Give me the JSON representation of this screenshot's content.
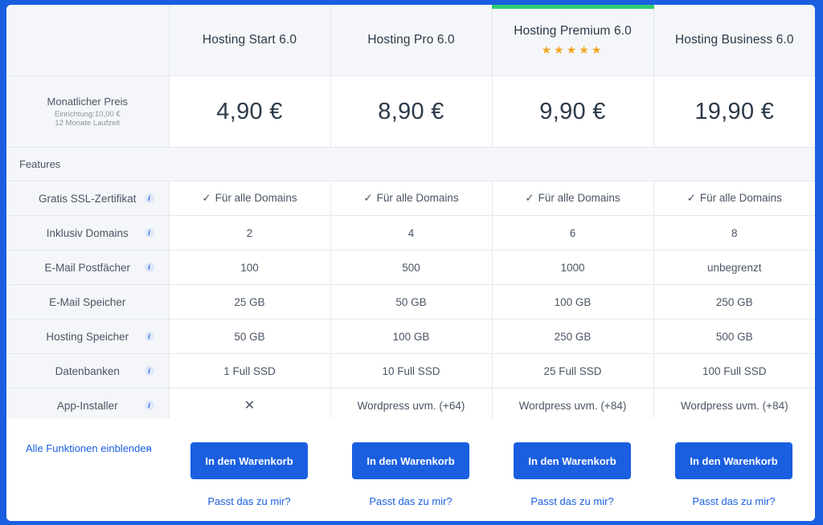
{
  "plans": [
    {
      "name": "Hosting Start 6.0",
      "price": "4,90 €",
      "ssl": "Für alle Domains",
      "domains": "2",
      "mailboxes": "100",
      "mail_storage": "25 GB",
      "hosting_storage": "50 GB",
      "databases": "1 Full SSD",
      "app_installer": "",
      "app_installer_icon": "cross-icon",
      "cart": "In den Warenkorb",
      "fit": "Passt das zu mir?"
    },
    {
      "name": "Hosting Pro 6.0",
      "price": "8,90 €",
      "ssl": "Für alle Domains",
      "domains": "4",
      "mailboxes": "500",
      "mail_storage": "50 GB",
      "hosting_storage": "100 GB",
      "databases": "10 Full SSD",
      "app_installer": "Wordpress uvm. (+64)",
      "cart": "In den Warenkorb",
      "fit": "Passt das zu mir?"
    },
    {
      "name": "Hosting Premium 6.0",
      "price": "9,90 €",
      "ssl": "Für alle Domains",
      "domains": "6",
      "mailboxes": "1000",
      "mail_storage": "100 GB",
      "hosting_storage": "250 GB",
      "databases": "25 Full SSD",
      "app_installer": "Wordpress uvm. (+84)",
      "cart": "In den Warenkorb",
      "fit": "Passt das zu mir?",
      "stars": "★★★★★",
      "rating": 5
    },
    {
      "name": "Hosting Business 6.0",
      "price": "19,90 €",
      "ssl": "Für alle Domains",
      "domains": "8",
      "mailboxes": "unbegrenzt",
      "mail_storage": "250 GB",
      "hosting_storage": "500 GB",
      "databases": "100 Full SSD",
      "app_installer": "Wordpress uvm. (+84)",
      "cart": "In den Warenkorb",
      "fit": "Passt das zu mir?"
    }
  ],
  "labels": {
    "price": "Monatlicher Preis",
    "setup": "Einrichtung:10,00 €",
    "term": "12 Monate Laufzeit",
    "features": "Features",
    "ssl": "Gratis SSL-Zertifikat",
    "domains": "Inklusiv Domains",
    "mailboxes": "E-Mail Postfächer",
    "mail_storage": "E-Mail Speicher",
    "hosting_storage": "Hosting Speicher",
    "databases": "Datenbanken",
    "app_installer": "App-Installer",
    "info": "i"
  },
  "toggle": {
    "label": "Alle Funktionen einblenden",
    "icon": "chevron-down-icon"
  },
  "colors": {
    "accent": "#1a5fe0",
    "success": "#27a845",
    "premium_bar": "#2ecc71",
    "star": "#f5a623"
  }
}
